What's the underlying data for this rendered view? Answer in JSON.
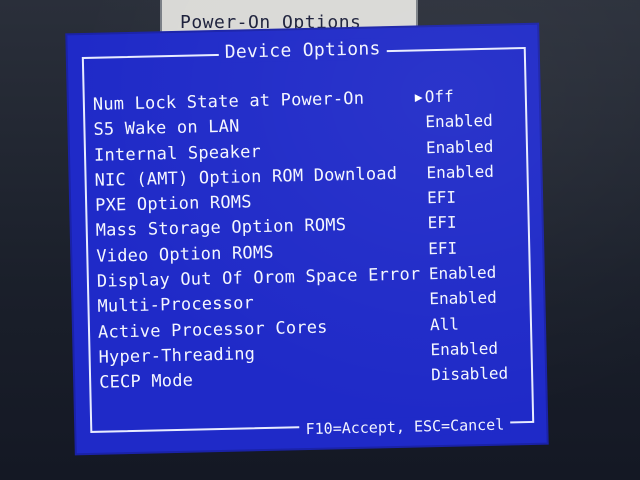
{
  "background_window": {
    "title": "Power-On Options"
  },
  "dialog": {
    "title": "Device Options",
    "footer": "F10=Accept, ESC=Cancel",
    "selected_marker": "▶",
    "options": [
      {
        "label": "Num Lock State at Power-On",
        "value": "Off",
        "selected": true
      },
      {
        "label": "S5 Wake on LAN",
        "value": "Enabled"
      },
      {
        "label": "Internal Speaker",
        "value": "Enabled"
      },
      {
        "label": "NIC (AMT) Option ROM Download",
        "value": "Enabled"
      },
      {
        "label": "PXE Option ROMS",
        "value": "EFI"
      },
      {
        "label": "Mass Storage Option ROMS",
        "value": "EFI"
      },
      {
        "label": "Video Option ROMS",
        "value": "EFI"
      },
      {
        "label": "Display Out Of Orom Space Error",
        "value": "Enabled"
      },
      {
        "label": "Multi-Processor",
        "value": "Enabled"
      },
      {
        "label": "Active Processor Cores",
        "value": "All"
      },
      {
        "label": "Hyper-Threading",
        "value": "Enabled"
      },
      {
        "label": "CECP Mode",
        "value": "Disabled"
      }
    ]
  },
  "colors": {
    "dialog_bg": "#1f2ac8",
    "text": "#f5f7ff",
    "frame": "#e8ecff"
  }
}
